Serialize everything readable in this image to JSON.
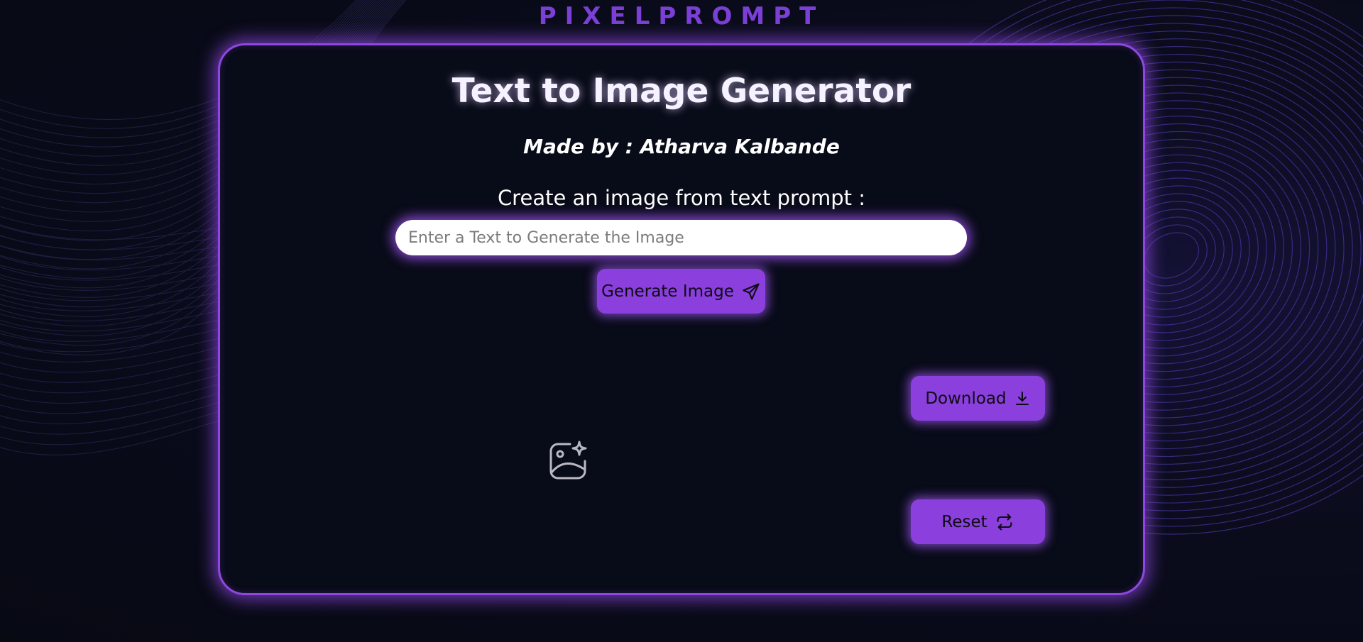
{
  "brand": {
    "logo_text": "PIXELPROMPT"
  },
  "card": {
    "title": "Text to Image Generator",
    "author": "Made by : Atharva Kalbande",
    "prompt_label": "Create an image from text prompt :",
    "input": {
      "placeholder": "Enter a Text to Generate the Image",
      "value": ""
    },
    "generate_button": {
      "label": "Generate Image",
      "icon": "send-icon"
    },
    "download_button": {
      "label": "Download",
      "icon": "download-icon"
    },
    "reset_button": {
      "label": "Reset",
      "icon": "repeat-icon"
    },
    "image_placeholder_icon": "image-sparkle-icon"
  },
  "colors": {
    "accent": "#8b3fdc",
    "background": "#080a18",
    "brand": "#7c3fd6"
  }
}
